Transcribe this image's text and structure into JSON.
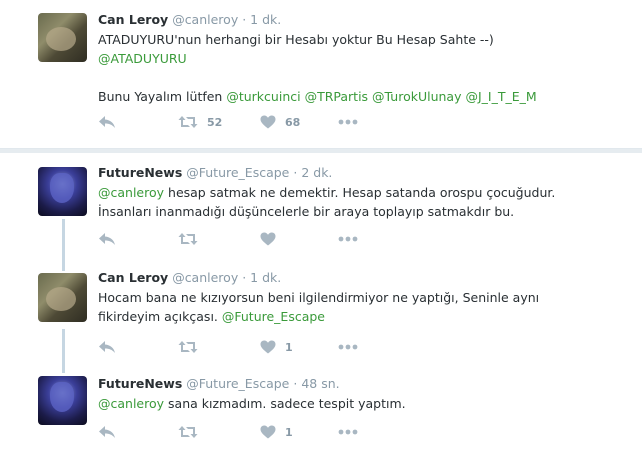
{
  "tweets": [
    {
      "name": "Can Leroy",
      "screen": "@canleroy",
      "dot": "·",
      "time": "1 dk.",
      "line1": "ATADUYURU'nun herhangi bir Hesabı yoktur Bu Hesap Sahte --)",
      "mention1": "@ATADUYURU",
      "line3": "Bunu Yayalım lütfen",
      "mentions": [
        "@turkcuinci",
        "@TRPartis",
        "@TurokUlunay",
        "@J_I_T_E_M"
      ],
      "retweets": "52",
      "likes": "68"
    },
    {
      "name": "FutureNews",
      "screen": "@Future_Escape",
      "dot": "·",
      "time": "2 dk.",
      "mention": "@canleroy",
      "rest1": "hesap satmak ne demektir. Hesap satanda orospu çocuğudur.",
      "line2": "İnsanları inanmadığı düşüncelerle bir araya toplayıp satmakdır bu."
    },
    {
      "name": "Can Leroy",
      "screen": "@canleroy",
      "dot": "·",
      "time": "1 dk.",
      "line1": "Hocam bana ne kızıyorsun beni ilgilendirmiyor ne yaptığı, Seninle aynı",
      "line2": "fikirdeyim açıkçası.",
      "mention": "@Future_Escape",
      "likes": "1"
    },
    {
      "name": "FutureNews",
      "screen": "@Future_Escape",
      "dot": "·",
      "time": "48 sn.",
      "mention": "@canleroy",
      "rest": "sana kızmadım. sadece tespit yaptım.",
      "likes": "1"
    }
  ],
  "icons": [
    "reply-icon",
    "retweet-icon",
    "like-icon",
    "more-icon"
  ],
  "colors": {
    "mention": "#3a9a3a",
    "muted": "#8899a6",
    "background": "#e6ecf0",
    "thread": "#c6d6e2"
  }
}
